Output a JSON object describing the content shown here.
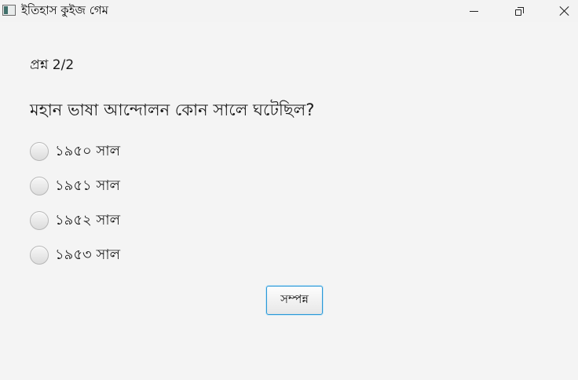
{
  "window": {
    "title": "ইতিহাস কুইজ গেম",
    "icon": "app-window-icon",
    "controls": [
      "minimize-icon",
      "maximize-icon",
      "close-icon"
    ]
  },
  "quiz": {
    "progress": "প্রশ্ন 2/2",
    "question": "মহান ভাষা আন্দোলন কোন সালে ঘটেছিল?",
    "options": [
      {
        "label": "১৯৫০ সাল",
        "selected": false
      },
      {
        "label": "১৯৫১ সাল",
        "selected": false
      },
      {
        "label": "১৯৫২ সাল",
        "selected": false
      },
      {
        "label": "১৯৫৩ সাল",
        "selected": false
      }
    ],
    "submit_label": "সম্পন্ন"
  },
  "colors": {
    "background": "#f4f4f4",
    "button_focus_border": "#2c98d6"
  }
}
